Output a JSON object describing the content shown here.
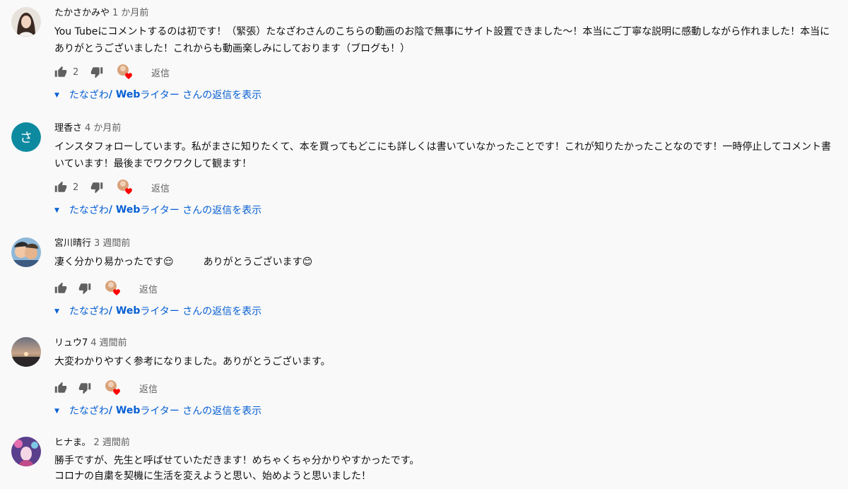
{
  "comments": [
    {
      "author": "たかさかみや",
      "time": "1 か月前",
      "text": "You Tubeにコメントするのは初です！（緊張）たなざわさんのこちらの動画のお陰で無事にサイト設置できました〜！本当にご丁寧な説明に感動しながら作れました！本当にありがとうございました！これからも動画楽しみにしております（ブログも！）",
      "likes": "2",
      "reply_label": "返信",
      "replies_prefix": "たなざわ",
      "replies_bold": " / Web",
      "replies_suffix": "ライター さんの返信を表示",
      "avatar": "photo-woman"
    },
    {
      "author": "理香さ",
      "time": "4 か月前",
      "text": "インスタフォローしています。私がまさに知りたくて、本を買ってもどこにも詳しくは書いていなかったことです！これが知りたかったことなのです！一時停止してコメント書いています！最後までワクワクして観ます！",
      "likes": "2",
      "reply_label": "返信",
      "replies_prefix": "たなざわ",
      "replies_bold": " / Web",
      "replies_suffix": "ライター さんの返信を表示",
      "avatar_letter": "さ",
      "avatar": "letter"
    },
    {
      "author": "宮川晴行",
      "time": "3 週間前",
      "text": "凄く分かり易かったです😌　　　ありがとうございます😊",
      "likes": "",
      "reply_label": "返信",
      "replies_prefix": "たなざわ",
      "replies_bold": " / Web",
      "replies_suffix": "ライター さんの返信を表示",
      "avatar": "cartoon"
    },
    {
      "author": "リュウ7",
      "time": "4 週間前",
      "text": "大変わかりやすく参考になりました。ありがとうございます。",
      "likes": "",
      "reply_label": "返信",
      "replies_prefix": "たなざわ",
      "replies_bold": " / Web",
      "replies_suffix": "ライター さんの返信を表示",
      "avatar": "sunset"
    },
    {
      "author": "ヒナま。",
      "time": "2 週間前",
      "text": "勝手ですが、先生と呼ばせていただきます！めちゃくちゃ分かりやすかったです。\nコロナの自粛を契機に生活を変えようと思い、始めようと思いました！",
      "avatar": "anime"
    }
  ],
  "colors": {
    "background": "#f9f9f9",
    "link_blue": "#065fd4",
    "meta_gray": "#606060",
    "heart_red": "#ff0000",
    "avatar_teal": "#0e8aa0"
  },
  "icons": {
    "like": "thumb-up-icon",
    "dislike": "thumb-down-icon",
    "creator_heart": "creator-heart-icon",
    "expand": "triangle-down-icon"
  }
}
